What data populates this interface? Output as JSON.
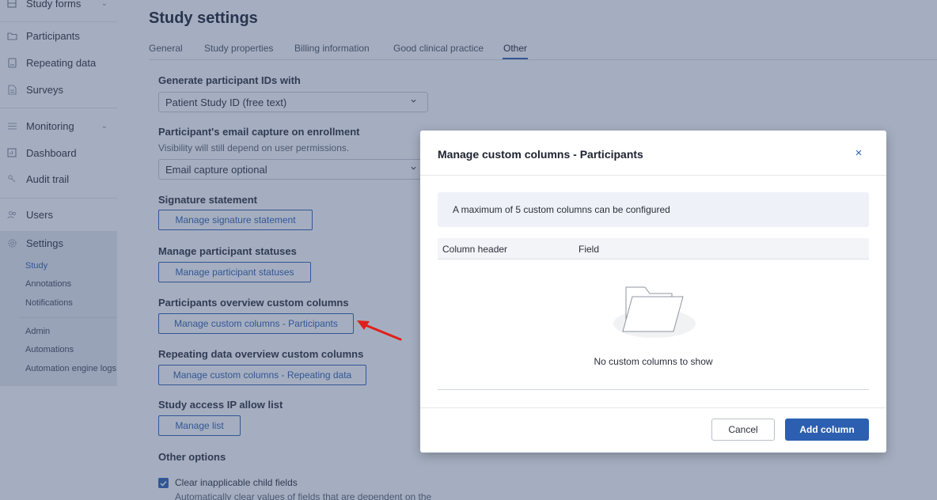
{
  "sidebar": {
    "items": [
      {
        "label": "Study forms",
        "icon": "grid-icon"
      },
      {
        "label": "Participants",
        "icon": "folder-icon"
      },
      {
        "label": "Repeating data",
        "icon": "stack-icon"
      },
      {
        "label": "Surveys",
        "icon": "document-icon"
      },
      {
        "label": "Monitoring",
        "icon": "list-icon"
      },
      {
        "label": "Dashboard",
        "icon": "chart-icon"
      },
      {
        "label": "Audit trail",
        "icon": "key-icon"
      },
      {
        "label": "Users",
        "icon": "users-icon"
      },
      {
        "label": "Settings",
        "icon": "gear-icon"
      }
    ],
    "settings_sub": [
      "Study",
      "Annotations",
      "Notifications",
      "Admin",
      "Automations",
      "Automation engine logs"
    ]
  },
  "page": {
    "title": "Study settings",
    "tabs": [
      "General",
      "Study properties",
      "Billing information",
      "Good clinical practice",
      "Other"
    ],
    "active_tab": "Other"
  },
  "sections": {
    "generate_ids": {
      "title": "Generate participant IDs with",
      "value": "Patient Study ID (free text)"
    },
    "email_capture": {
      "title": "Participant's email capture on enrollment",
      "desc": "Visibility will still depend on user permissions.",
      "value": "Email capture optional"
    },
    "signature": {
      "title": "Signature statement",
      "button": "Manage signature statement"
    },
    "statuses": {
      "title": "Manage participant statuses",
      "button": "Manage participant statuses"
    },
    "participants_cols": {
      "title": "Participants overview custom columns",
      "button": "Manage custom columns - Participants"
    },
    "repeating_cols": {
      "title": "Repeating data overview custom columns",
      "button": "Manage custom columns - Repeating data"
    },
    "ip_list": {
      "title": "Study access IP allow list",
      "button": "Manage list"
    },
    "other": {
      "title": "Other options",
      "checkbox_label": "Clear inapplicable child fields",
      "checkbox_checked": true,
      "checkbox_desc": "Automatically clear values of fields that are dependent on the"
    }
  },
  "modal": {
    "title": "Manage custom columns - Participants",
    "close": "×",
    "info": "A maximum of 5 custom columns can be configured",
    "columns": [
      "Column header",
      "Field"
    ],
    "empty_text": "No custom columns to show",
    "cancel": "Cancel",
    "add": "Add column"
  },
  "colors": {
    "accent": "#2c5fb0",
    "annotation_arrow": "#e0201a"
  }
}
